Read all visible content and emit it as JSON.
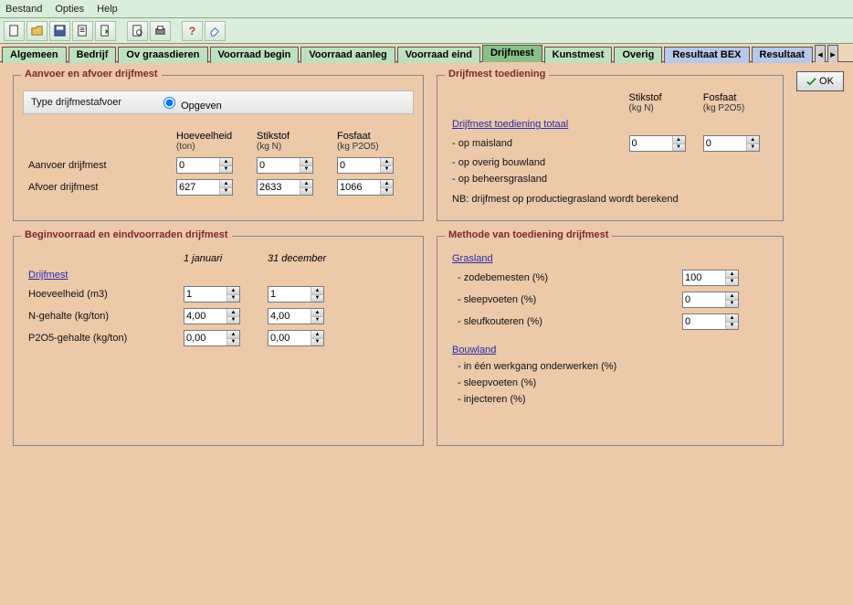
{
  "menu": {
    "file": "Bestand",
    "options": "Opties",
    "help": "Help"
  },
  "tabs": {
    "algemeen": "Algemeen",
    "bedrijf": "Bedrijf",
    "ovgraasdieren": "Ov graasdieren",
    "voorraad_begin": "Voorraad begin",
    "voorraad_aanleg": "Voorraad aanleg",
    "voorraad_eind": "Voorraad eind",
    "drijfmest": "Drijfmest",
    "kunstmest": "Kunstmest",
    "overig": "Overig",
    "resultaat_bex": "Resultaat BEX",
    "resultaat": "Resultaat"
  },
  "ok_label": "OK",
  "box1": {
    "title": "Aanvoer en afvoer drijfmest",
    "type_label": "Type drijfmestafvoer",
    "type_option": "Opgeven",
    "col_hoeveelheid": "Hoeveelheid",
    "col_hoeveelheid_sub": "(ton)",
    "col_stikstof": "Stikstof",
    "col_stikstof_sub": "(kg N)",
    "col_fosfaat": "Fosfaat",
    "col_fosfaat_sub": "(kg P2O5)",
    "row_aanvoer": "Aanvoer drijfmest",
    "row_afvoer": "Afvoer drijfmest",
    "aanvoer_hoeveelheid": "0",
    "aanvoer_stikstof": "0",
    "aanvoer_fosfaat": "0",
    "afvoer_hoeveelheid": "627",
    "afvoer_stikstof": "2633",
    "afvoer_fosfaat": "1066"
  },
  "box2": {
    "title": "Drijfmest toediening",
    "totaal_link": "Drijfmest toediening totaal",
    "col_stikstof": "Stikstof",
    "col_stikstof_sub": "(kg N)",
    "col_fosfaat": "Fosfaat",
    "col_fosfaat_sub": "(kg P2O5)",
    "row_maisland": "- op maisland",
    "row_bouwland": "- op overig bouwland",
    "row_beheers": "- op beheersgrasland",
    "nb": "NB: drijfmest op productiegrasland wordt berekend",
    "maisland_n": "0",
    "maisland_p": "0"
  },
  "box3": {
    "title": "Beginvoorraad en eindvoorraden drijfmest",
    "col_jan": "1 januari",
    "col_dec": "31 december",
    "row_drijfmest": "Drijfmest",
    "row_hoeveelheid": "Hoeveelheid (m3)",
    "row_ngehalte": "N-gehalte (kg/ton)",
    "row_p2o5gehalte": "P2O5-gehalte  (kg/ton)",
    "hoeveelheid_jan": "1",
    "hoeveelheid_dec": "1",
    "ngehalte_jan": "4,00",
    "ngehalte_dec": "4,00",
    "p2o5_jan": "0,00",
    "p2o5_dec": "0,00"
  },
  "box4": {
    "title": "Methode van toediening drijfmest",
    "grasland": "Grasland",
    "zodebemesten": "- zodebemesten (%)",
    "sleepvoeten_g": "- sleepvoeten (%)",
    "sleufkouteren": "- sleufkouteren (%)",
    "bouwland": "Bouwland",
    "onderwerken": "- in één werkgang onderwerken (%)",
    "sleepvoeten_b": "- sleepvoeten (%)",
    "injecteren": "- injecteren (%)",
    "zodebemesten_v": "100",
    "sleepvoeten_g_v": "0",
    "sleufkouteren_v": "0"
  }
}
